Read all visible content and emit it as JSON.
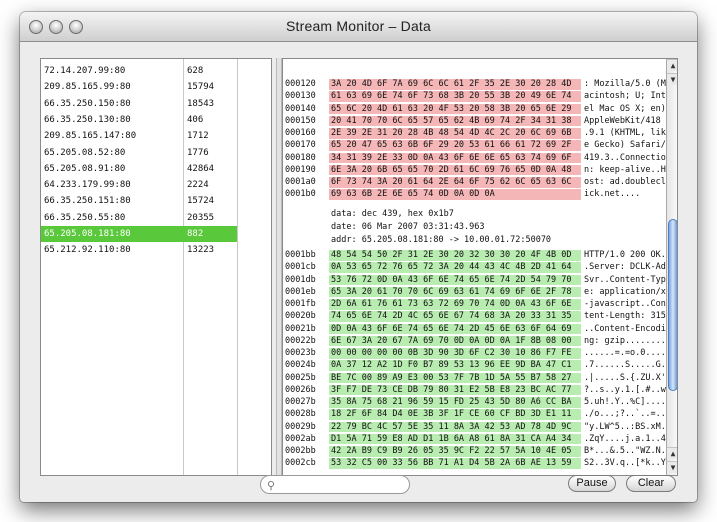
{
  "window": {
    "title": "Stream Monitor – Data"
  },
  "connections": [
    {
      "address": "72.14.207.99:80",
      "size": "628",
      "selected": false
    },
    {
      "address": "209.85.165.99:80",
      "size": "15794",
      "selected": false
    },
    {
      "address": "66.35.250.150:80",
      "size": "18543",
      "selected": false
    },
    {
      "address": "66.35.250.130:80",
      "size": "406",
      "selected": false
    },
    {
      "address": "209.85.165.147:80",
      "size": "1712",
      "selected": false
    },
    {
      "address": "65.205.08.52:80",
      "size": "1776",
      "selected": false
    },
    {
      "address": "65.205.08.91:80",
      "size": "42864",
      "selected": false
    },
    {
      "address": "64.233.179.99:80",
      "size": "2224",
      "selected": false
    },
    {
      "address": "66.35.250.151:80",
      "size": "15724",
      "selected": false
    },
    {
      "address": "66.35.250.55:80",
      "size": "20355",
      "selected": false
    },
    {
      "address": "65.205.08.181:80",
      "size": "882",
      "selected": true
    },
    {
      "address": "65.212.92.110:80",
      "size": "13223",
      "selected": false
    }
  ],
  "request_rows": [
    {
      "offset": "000120",
      "hex": "3A 20 4D 6F 7A 69 6C 6C  61 2F 35 2E 30 20 28 4D",
      "ascii": ": Mozilla/5.0 (M"
    },
    {
      "offset": "000130",
      "hex": "61 63 69 6E 74 6F 73 68  3B 20 55 3B 20 49 6E 74",
      "ascii": "acintosh; U; Int"
    },
    {
      "offset": "000140",
      "hex": "65 6C 20 4D 61 63 20 4F  53 20 58 3B 20 65 6E 29",
      "ascii": "el Mac OS X; en)"
    },
    {
      "offset": "000150",
      "hex": "20 41 70 70 6C 65 57 65  62 4B 69 74 2F 34 31 38",
      "ascii": " AppleWebKit/418"
    },
    {
      "offset": "000160",
      "hex": "2E 39 2E 31 20 28 4B 48  54 4D 4C 2C 20 6C 69 6B",
      "ascii": ".9.1 (KHTML, lik"
    },
    {
      "offset": "000170",
      "hex": "65 20 47 65 63 6B 6F 29  20 53 61 66 61 72 69 2F",
      "ascii": "e Gecko) Safari/"
    },
    {
      "offset": "000180",
      "hex": "34 31 39 2E 33 0D 0A 43  6F 6E 6E 65 63 74 69 6F",
      "ascii": "419.3..Connectio"
    },
    {
      "offset": "000190",
      "hex": "6E 3A 20 6B 65 65 70 2D  61 6C 69 76 65 0D 0A 48",
      "ascii": "n: keep-alive..H"
    },
    {
      "offset": "0001a0",
      "hex": "6F 73 74 3A 20 61 64 2E  64 6F 75 62 6C 65 63 6C",
      "ascii": "ost: ad.doublecl"
    },
    {
      "offset": "0001b0",
      "hex": "69 63 6B 2E 6E 65 74 0D  0A 0D 0A",
      "ascii": "ick.net...."
    }
  ],
  "meta": {
    "data_line": "data: dec 439, hex 0x1b7",
    "date_line": "date: 06 Mar 2007 03:31:43.963",
    "addr_line": "addr: 65.205.08.181:80 -> 10.00.01.72:50070"
  },
  "response_rows": [
    {
      "offset": "0001bb",
      "hex": "48 54 54 50 2F 31 2E 30  20 32 30 30 20 4F 4B 0D",
      "ascii": "HTTP/1.0 200 OK."
    },
    {
      "offset": "0001cb",
      "hex": "0A 53 65 72 76 65 72 3A  20 44 43 4C 4B 2D 41 64",
      "ascii": ".Server: DCLK-Ad"
    },
    {
      "offset": "0001db",
      "hex": "53 76 72 0D 0A 43 6F 6E  74 65 6E 74 2D 54 79 70",
      "ascii": "Svr..Content-Typ"
    },
    {
      "offset": "0001eb",
      "hex": "65 3A 20 61 70 70 6C 69  63 61 74 69 6F 6E 2F 78",
      "ascii": "e: application/x"
    },
    {
      "offset": "0001fb",
      "hex": "2D 6A 61 76 61 73 63 72  69 70 74 0D 0A 43 6F 6E",
      "ascii": "-javascript..Con"
    },
    {
      "offset": "00020b",
      "hex": "74 65 6E 74 2D 4C 65 6E  67 74 68 3A 20 33 31 35",
      "ascii": "tent-Length: 315"
    },
    {
      "offset": "00021b",
      "hex": "0D 0A 43 6F 6E 74 65 6E  74 2D 45 6E 63 6F 64 69",
      "ascii": "..Content-Encodi"
    },
    {
      "offset": "00022b",
      "hex": "6E 67 3A 20 67 7A 69 70  0D 0A 0D 0A 1F 8B 08 00",
      "ascii": "ng: gzip........"
    },
    {
      "offset": "00023b",
      "hex": "00 00 00 00 00 0B 3D 90  3D 6F C2 30 10 86 F7 FE",
      "ascii": "......=.=o.0...."
    },
    {
      "offset": "00024b",
      "hex": "0A 37 12 A2 1D F0 B7 89  53 13 96 EE 9D BA 47 C1",
      "ascii": ".7......S.....G."
    },
    {
      "offset": "00025b",
      "hex": "BE 7C 00 89 A9 E3 00 53  7F 7B 1D 5A 55 B7 58 27",
      "ascii": ".|.....S.{.ZU.X'"
    },
    {
      "offset": "00026b",
      "hex": "3F F7 DE 73 CE DB 79 80  31 E2 5B E8 23 BC AC 77",
      "ascii": "?..s..y.1.[.#..w"
    },
    {
      "offset": "00027b",
      "hex": "35 8A 75 68 21 96 59 15  FD 25 43 5D 80 A6 CC BA",
      "ascii": "5.uh!.Y..%C]...."
    },
    {
      "offset": "00028b",
      "hex": "18 2F 6F 84 D4 0E 3B 3F  1F CE 60 CF BD 3D E1 11",
      "ascii": "./o...;?..`..=.."
    },
    {
      "offset": "00029b",
      "hex": "22 79 BC 4C 57 5E 35 11  8A 3A 42 53 AD 78 4D 9C",
      "ascii": "\"y.LW^5..:BS.xM."
    },
    {
      "offset": "0002ab",
      "hex": "D1 5A 71 59 E8 AD D1 1B  6A A8 61 8A 31 CA A4 34",
      "ascii": ".ZqY....j.a.1..4"
    },
    {
      "offset": "0002bb",
      "hex": "42 2A B9 C9 B9 26 05 35  9C F2 22 57 5A 10 4E 05",
      "ascii": "B*...&.5..\"WZ.N."
    },
    {
      "offset": "0002cb",
      "hex": "53 32 C5 00 33 56 BB 71  A1 D4 5B 2A 6B AE 13 59",
      "ascii": "S2..3V.q..[*k..Y"
    }
  ],
  "search": {
    "placeholder": "",
    "value": ""
  },
  "buttons": {
    "pause": "Pause",
    "clear": "Clear"
  },
  "icons": {
    "search": "search-icon",
    "scroll_up": "scroll-up-arrow-icon",
    "scroll_down": "scroll-down-arrow-icon"
  }
}
